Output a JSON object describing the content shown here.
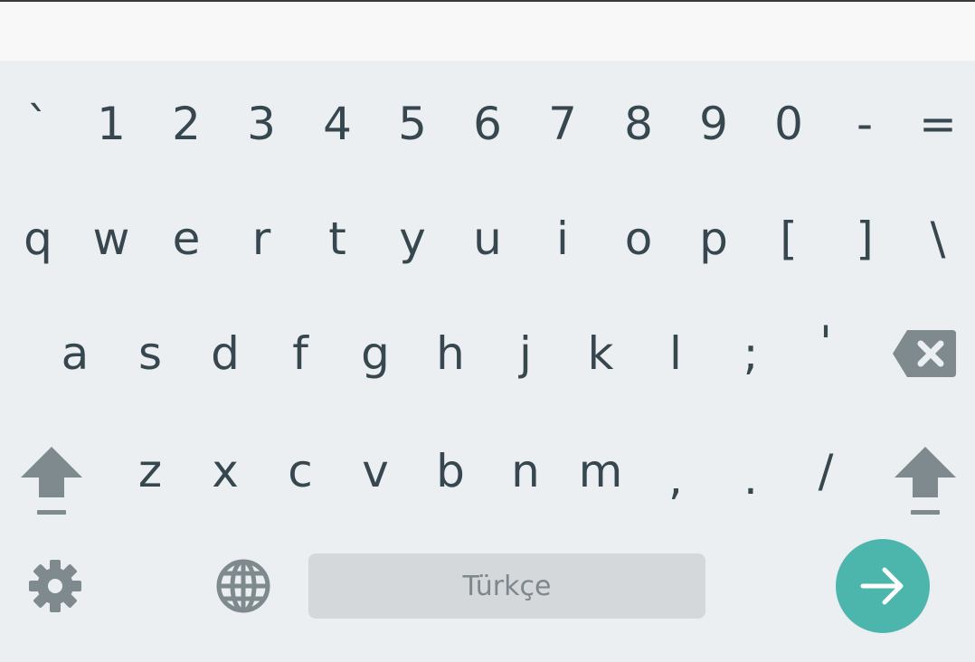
{
  "keyboard": {
    "rows": [
      [
        "`",
        "1",
        "2",
        "3",
        "4",
        "5",
        "6",
        "7",
        "8",
        "9",
        "0",
        "-",
        "="
      ],
      [
        "q",
        "w",
        "e",
        "r",
        "t",
        "y",
        "u",
        "i",
        "o",
        "p",
        "[",
        "]",
        "\\"
      ],
      [
        "a",
        "s",
        "d",
        "f",
        "g",
        "h",
        "j",
        "k",
        "l",
        ";",
        "'"
      ],
      [
        "z",
        "x",
        "c",
        "v",
        "b",
        "n",
        "m",
        ",",
        ".",
        "/"
      ]
    ],
    "space_label": "Türkçe",
    "colors": {
      "background": "#eceff1",
      "key_text": "#37474f",
      "icon": "#7f8a8f",
      "space_bar": "#d4d8db",
      "enter": "#4db6ac"
    },
    "icons": {
      "backspace": "backspace-icon",
      "shift_left": "shift-arrow-icon",
      "shift_right": "shift-arrow-icon",
      "settings": "gear-icon",
      "language": "globe-icon",
      "enter": "arrow-right-icon"
    }
  }
}
